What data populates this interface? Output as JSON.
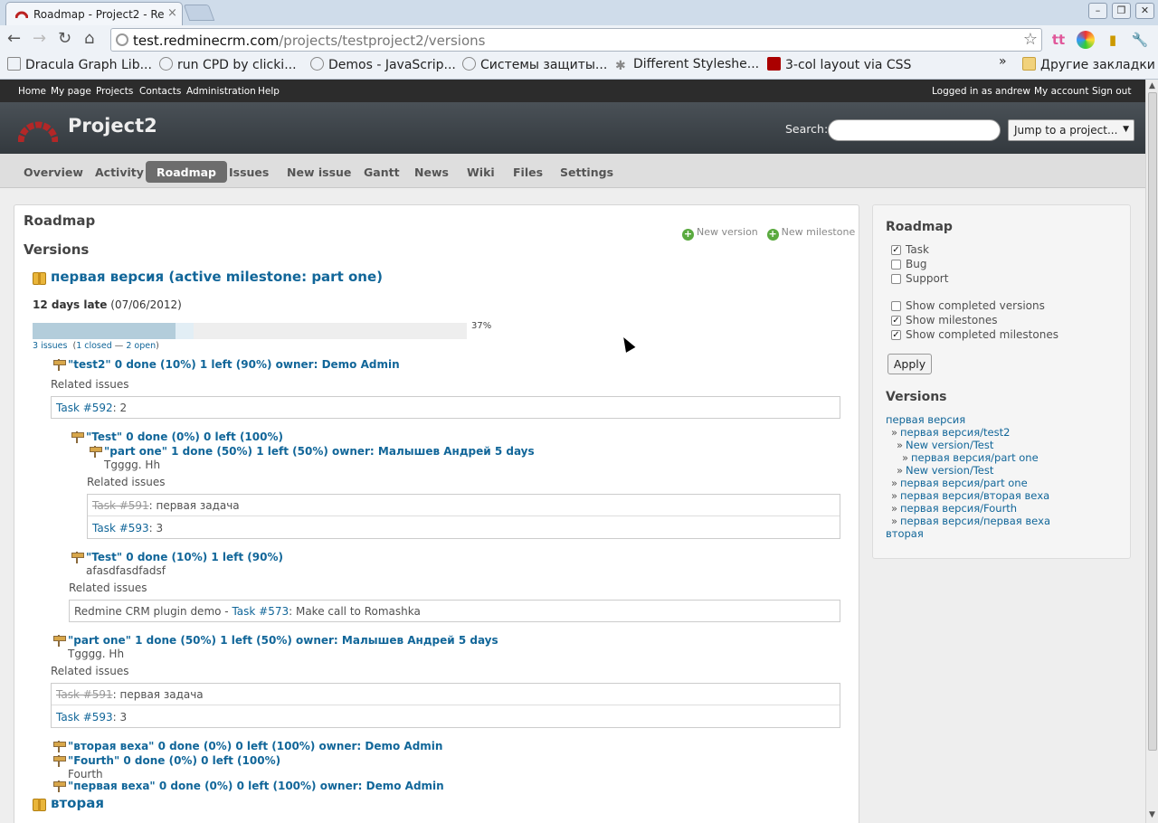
{
  "browser": {
    "tab_title": "Roadmap - Project2 - Re",
    "url_host": "test.redminecrm.com",
    "url_path": "/projects/testproject2/versions",
    "bookmarks": [
      "Dracula Graph Lib...",
      "run CPD by clicki...",
      "Demos - JavaScrip...",
      "Системы защиты...",
      "Different Styleshe...",
      "3-col layout via CSS"
    ],
    "bookmarks_more": "»",
    "other_bookmarks": "Другие закладки"
  },
  "top_menu": {
    "left": [
      "Home",
      "My page",
      "Projects",
      "Contacts",
      "Administration",
      "Help"
    ],
    "logged_in": "Logged in as andrew",
    "my_account": "My account",
    "sign_out": "Sign out"
  },
  "header": {
    "project": "Project2",
    "search_label": "Search:",
    "jump_label": "Jump to a project..."
  },
  "main_menu": [
    "Overview",
    "Activity",
    "Roadmap",
    "Issues",
    "New issue",
    "Gantt",
    "News",
    "Wiki",
    "Files",
    "Settings"
  ],
  "main_menu_selected": "Roadmap",
  "content": {
    "title": "Roadmap",
    "subtitle": "Versions",
    "new_version": "New version",
    "new_milestone": "New milestone",
    "version1": {
      "title": "первая версия (active milestone: part one)",
      "late": "12 days late",
      "date": "(07/06/2012)",
      "progress_closed_pct": 33,
      "progress_done_pct": 37,
      "progress_label": "37%",
      "issues_link": "3 issues",
      "counts_open": "(",
      "closed_link": "1 closed",
      "dash": " — ",
      "open_link": "2 open",
      "counts_close": ")"
    },
    "ms_test2": "\"test2\" 0 done (10%) 1 left (90%) owner: Demo Admin",
    "related_issues": "Related issues",
    "rel_task592": {
      "link": "Task #592",
      "rest": ": 2"
    },
    "ms_test_a": "\"Test\" 0 done (0%) 0 left (100%)",
    "ms_partone_inner": "\"part one\" 1 done (50%) 1 left (50%) owner: Малышев Андрей 5 days",
    "tgggg_inner": "Tgggg. Hh",
    "rel_task591_inner": {
      "link": "Task #591",
      "rest": ": первая задача"
    },
    "rel_task593_inner": {
      "link": "Task #593",
      "rest": ": 3"
    },
    "ms_test_b": "\"Test\" 0 done (10%) 1 left (90%)",
    "afas": "afasdfasdfadsf",
    "rel_task573": {
      "prefix": "Redmine CRM plugin demo - ",
      "link": "Task #573",
      "rest": ": Make call to Romashka"
    },
    "ms_partone": "\"part one\" 1 done (50%) 1 left (50%) owner: Малышев Андрей 5 days",
    "tgggg": "Tgggg. Hh",
    "rel_task591": {
      "link": "Task #591",
      "rest": ": первая задача"
    },
    "rel_task593": {
      "link": "Task #593",
      "rest": ": 3"
    },
    "ms_vtoraya_veha": "\"вторая веха\" 0 done (0%) 0 left (100%) owner: Demo Admin",
    "ms_fourth": "\"Fourth\" 0 done (0%) 0 left (100%)",
    "fourth_desc": "Fourth",
    "ms_pervaya_veha": "\"первая веха\" 0 done (0%) 0 left (100%) owner: Demo Admin",
    "version2_title": "вторая"
  },
  "sidebar": {
    "title": "Roadmap",
    "trackers": [
      {
        "label": "Task",
        "checked": true
      },
      {
        "label": "Bug",
        "checked": false
      },
      {
        "label": "Support",
        "checked": false
      }
    ],
    "options": [
      {
        "label": "Show completed versions",
        "checked": false
      },
      {
        "label": "Show milestones",
        "checked": true
      },
      {
        "label": "Show completed milestones",
        "checked": true
      }
    ],
    "apply": "Apply",
    "versions_title": "Versions",
    "versions": [
      "первая версия",
      "первая версия/test2",
      "New version/Test",
      "первая версия/part one",
      "New version/Test",
      "первая версия/part one",
      "первая версия/вторая веха",
      "первая версия/Fourth",
      "первая версия/первая веха",
      "вторая"
    ],
    "raquo": "»"
  },
  "colors": {
    "link": "#116699",
    "top_menu": "#2c2c2c",
    "header": "#3e454b",
    "selected_tab": "#6d6d6d",
    "progress_closed": "#b3cddb",
    "progress_done": "#e2eef5"
  }
}
